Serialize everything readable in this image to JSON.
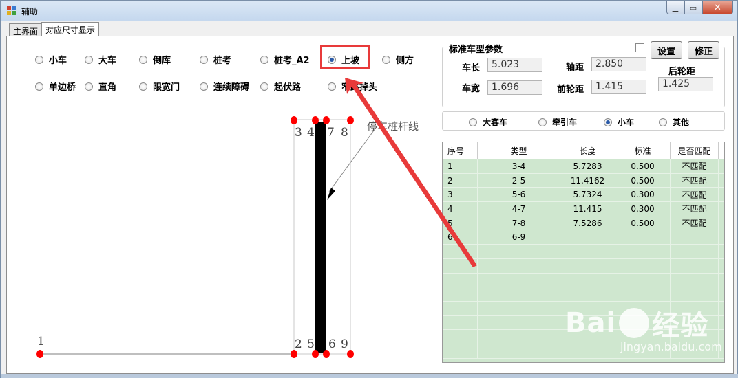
{
  "window": {
    "title": "辅助"
  },
  "tabs": [
    {
      "label": "主界面"
    },
    {
      "label": "对应尺寸显示"
    }
  ],
  "exam_items": [
    {
      "label": "小车",
      "selected": false
    },
    {
      "label": "大车",
      "selected": false
    },
    {
      "label": "倒库",
      "selected": false
    },
    {
      "label": "桩考",
      "selected": false
    },
    {
      "label": "桩考_A2",
      "selected": false
    },
    {
      "label": "上坡",
      "selected": true
    },
    {
      "label": "侧方",
      "selected": false
    },
    {
      "label": "单边桥",
      "selected": false
    },
    {
      "label": "直角",
      "selected": false
    },
    {
      "label": "限宽门",
      "selected": false
    },
    {
      "label": "连续障碍",
      "selected": false
    },
    {
      "label": "起伏路",
      "selected": false
    },
    {
      "label": "窄路掉头",
      "selected": false
    }
  ],
  "params": {
    "title": "标准车型参数",
    "length_label": "车长",
    "length_value": "5.023",
    "wheelbase_label": "轴距",
    "wheelbase_value": "2.850",
    "rear_track_label": "后轮距",
    "width_label": "车宽",
    "width_value": "1.696",
    "front_track_label": "前轮距",
    "front_track_value": "1.415",
    "rear_track_value": "1.425",
    "set_button": "设置",
    "correct_button": "修正"
  },
  "vehicle_types": [
    {
      "label": "大客车",
      "selected": false
    },
    {
      "label": "牵引车",
      "selected": false
    },
    {
      "label": "小车",
      "selected": true
    },
    {
      "label": "其他",
      "selected": false
    }
  ],
  "table": {
    "headers": [
      "序号",
      "类型",
      "长度",
      "标准",
      "是否匹配"
    ],
    "rows": [
      [
        "1",
        "3-4",
        "5.7283",
        "0.500",
        "不匹配"
      ],
      [
        "2",
        "2-5",
        "11.4162",
        "0.500",
        "不匹配"
      ],
      [
        "3",
        "5-6",
        "5.7324",
        "0.300",
        "不匹配"
      ],
      [
        "4",
        "4-7",
        "11.415",
        "0.300",
        "不匹配"
      ],
      [
        "5",
        "7-8",
        "7.5286",
        "0.500",
        "不匹配"
      ],
      [
        "6",
        "6-9",
        "",
        "",
        ""
      ]
    ]
  },
  "diagram": {
    "labels": [
      "1",
      "2",
      "3",
      "4",
      "5",
      "6",
      "7",
      "8",
      "9"
    ],
    "annotation": "停车桩杆线"
  },
  "watermark": {
    "main_left": "Bai",
    "main_right": "经验",
    "sub": "jingyan.baidu.com"
  },
  "colors": {
    "highlight": "#e83a3a",
    "grid_bg": "#cfe7cf",
    "marker": "#ff0000"
  }
}
